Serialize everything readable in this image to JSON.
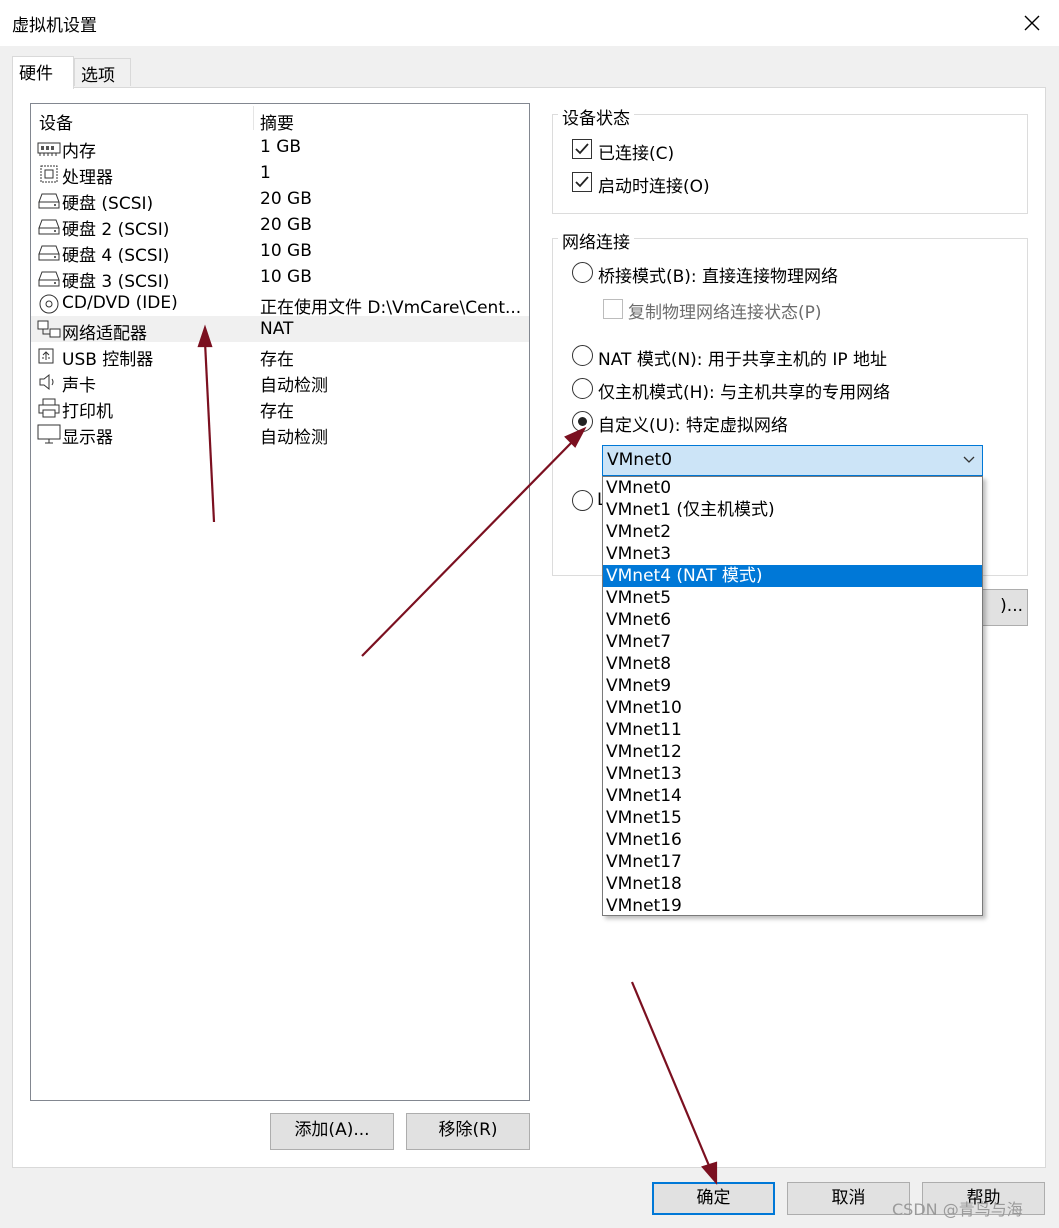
{
  "window": {
    "title": "虚拟机设置"
  },
  "tabs": [
    {
      "label": "硬件"
    },
    {
      "label": "选项"
    }
  ],
  "device_list": {
    "headers": {
      "device": "设备",
      "summary": "摘要"
    },
    "rows": [
      {
        "name": "内存",
        "summary": "1 GB",
        "icon": "memory-icon"
      },
      {
        "name": "处理器",
        "summary": "1",
        "icon": "processor-icon"
      },
      {
        "name": "硬盘 (SCSI)",
        "summary": "20 GB",
        "icon": "hard-disk-icon"
      },
      {
        "name": "硬盘 2 (SCSI)",
        "summary": "20 GB",
        "icon": "hard-disk-icon"
      },
      {
        "name": "硬盘 4 (SCSI)",
        "summary": "10 GB",
        "icon": "hard-disk-icon"
      },
      {
        "name": "硬盘 3 (SCSI)",
        "summary": "10 GB",
        "icon": "hard-disk-icon"
      },
      {
        "name": "CD/DVD (IDE)",
        "summary": "正在使用文件 D:\\VmCare\\Cent...",
        "icon": "cd-dvd-icon"
      },
      {
        "name": "网络适配器",
        "summary": "NAT",
        "icon": "network-adapter-icon",
        "selected": true
      },
      {
        "name": "USB 控制器",
        "summary": "存在",
        "icon": "usb-icon"
      },
      {
        "name": "声卡",
        "summary": "自动检测",
        "icon": "speaker-icon"
      },
      {
        "name": "打印机",
        "summary": "存在",
        "icon": "printer-icon"
      },
      {
        "name": "显示器",
        "summary": "自动检测",
        "icon": "monitor-icon"
      }
    ],
    "add_button": "添加(A)...",
    "remove_button": "移除(R)"
  },
  "device_status": {
    "title": "设备状态",
    "connected": {
      "label": "已连接(C)",
      "checked": true
    },
    "connect_on_power": {
      "label": "启动时连接(O)",
      "checked": true
    }
  },
  "network_connection": {
    "title": "网络连接",
    "bridged": {
      "label": "桥接模式(B): 直接连接物理网络",
      "selected": false
    },
    "replicate": {
      "label": "复制物理网络连接状态(P)",
      "checked": false,
      "enabled": false
    },
    "nat": {
      "label": "NAT 模式(N): 用于共享主机的 IP 地址",
      "selected": false
    },
    "host_only": {
      "label": "仅主机模式(H): 与主机共享的专用网络",
      "selected": false
    },
    "custom": {
      "label": "自定义(U): 特定虚拟网络",
      "selected": true
    },
    "lan_segment_partial": "L",
    "combo_value": "VMnet0",
    "options": [
      "VMnet0",
      "VMnet1 (仅主机模式)",
      "VMnet2",
      "VMnet3",
      "VMnet4 (NAT 模式)",
      "VMnet5",
      "VMnet6",
      "VMnet7",
      "VMnet8",
      "VMnet9",
      "VMnet10",
      "VMnet11",
      "VMnet12",
      "VMnet13",
      "VMnet14",
      "VMnet15",
      "VMnet16",
      "VMnet17",
      "VMnet18",
      "VMnet19"
    ],
    "highlighted_option": "VMnet4 (NAT 模式)",
    "advanced_button_partial": ")..."
  },
  "footer": {
    "ok": "确定",
    "cancel": "取消",
    "help": "帮助"
  },
  "watermark": "CSDN @青鸟与海",
  "colors": {
    "accent": "#0078d7",
    "arrow": "#7b1020",
    "combo_bg": "#cce4f7"
  }
}
